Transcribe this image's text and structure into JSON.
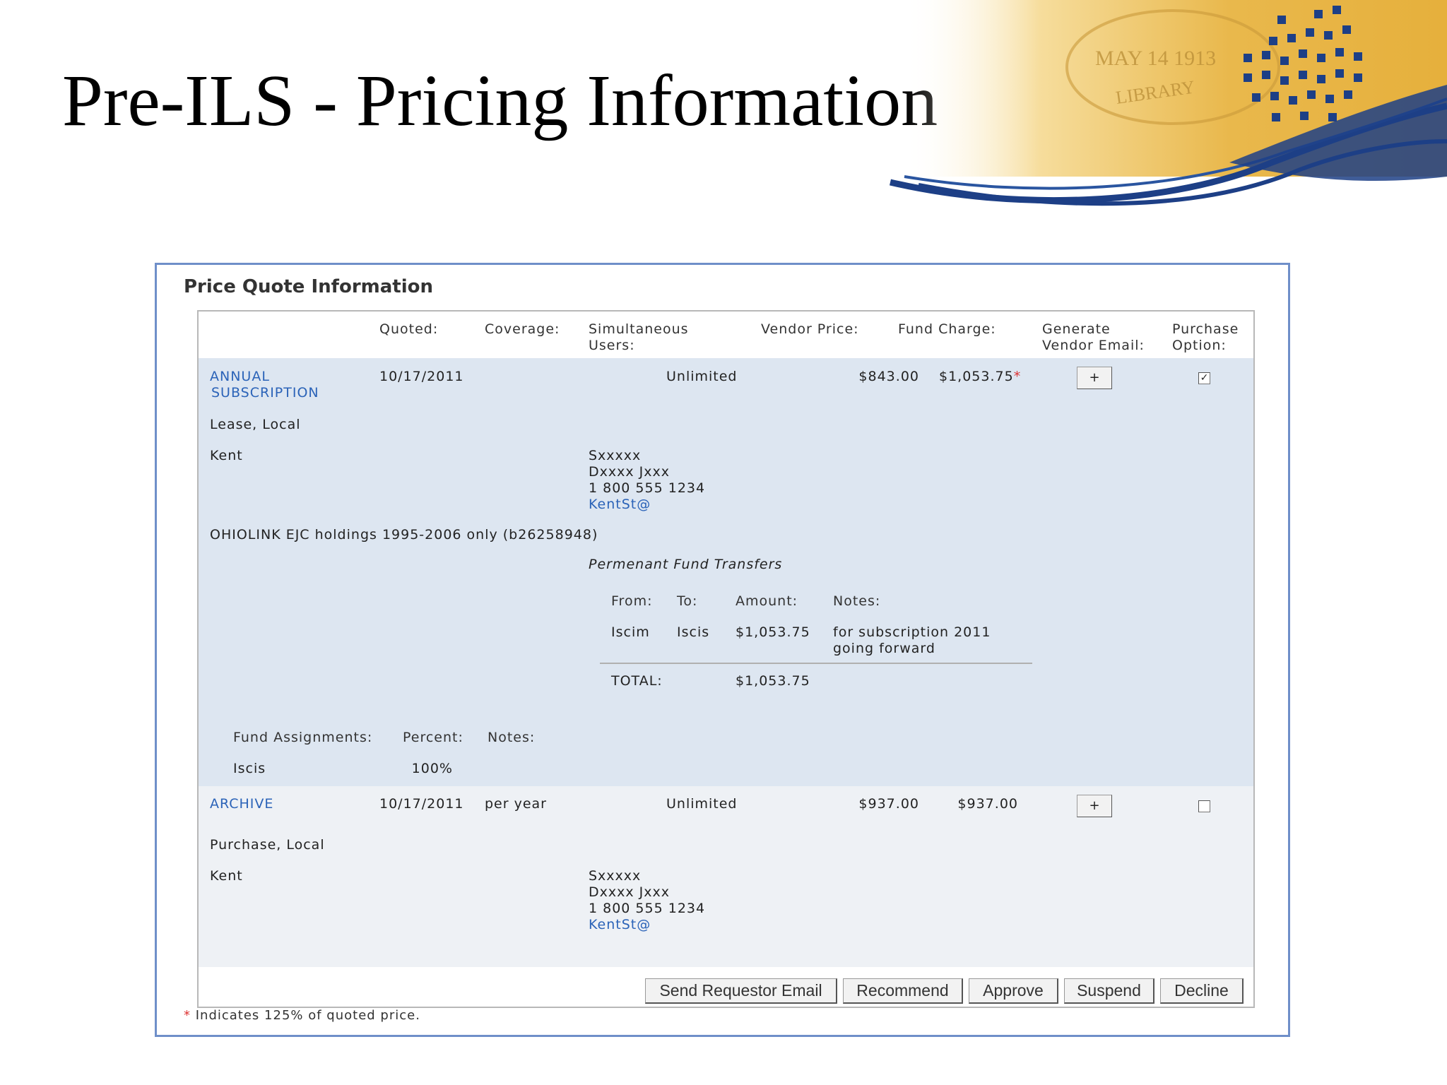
{
  "slide": {
    "title": "Pre-ILS - Pricing Information"
  },
  "banner": {
    "stamp_text": "MAY 14 1913",
    "stamp_subtext": "LIBRARY"
  },
  "panel": {
    "title": "Price Quote Information",
    "columns": [
      "Quoted:",
      "Coverage:",
      "Simultaneous Users:",
      "Vendor Price:",
      "Fund Charge:",
      "Generate Vendor Email:",
      "Purchase Option:"
    ],
    "columns_split": {
      "simultaneous_1": "Simultaneous",
      "simultaneous_2": "Users:",
      "generate_1": "Generate",
      "generate_2": "Vendor Email:",
      "purchase_1": "Purchase",
      "purchase_2": "Option:"
    },
    "quotes": [
      {
        "name_line1": "ANNUAL",
        "name_line2": "SUBSCRIPTION",
        "quoted": "10/17/2011",
        "coverage": "",
        "users": "Unlimited",
        "vendor_price": "$843.00",
        "fund_charge": "$1,053.75",
        "fund_charge_mark": "*",
        "email_button": "+",
        "purchase_checked": true,
        "terms": "Lease, Local",
        "location": "Kent",
        "contact": [
          "Sxxxxx",
          "Dxxxx Jxxx",
          "1 800 555 1234"
        ],
        "contact_email": "KentSt@",
        "holdings_note": "OHIOLINK EJC holdings 1995-2006 only (b26258948)",
        "transfers": {
          "title": "Permenant Fund Transfers",
          "headers": [
            "From:",
            "To:",
            "Amount:",
            "Notes:"
          ],
          "rows": [
            {
              "from": "Iscim",
              "to": "Iscis",
              "amount": "$1,053.75",
              "notes_line1": "for subscription 2011",
              "notes_line2": "going forward"
            }
          ],
          "total_label": "TOTAL:",
          "total_amount": "$1,053.75"
        },
        "assignments": {
          "headers": [
            "Fund Assignments:",
            "Percent:",
            "Notes:"
          ],
          "rows": [
            {
              "fund": "Iscis",
              "percent": "100%",
              "notes": ""
            }
          ]
        }
      },
      {
        "name_line1": "ARCHIVE",
        "quoted": "10/17/2011",
        "coverage": "per year",
        "users": "Unlimited",
        "vendor_price": "$937.00",
        "fund_charge": "$937.00",
        "email_button": "+",
        "purchase_checked": false,
        "terms": "Purchase, Local",
        "location": "Kent",
        "contact": [
          "Sxxxxx",
          "Dxxxx Jxxx",
          "1 800 555 1234"
        ],
        "contact_email": "KentSt@"
      }
    ],
    "actions": [
      "Send Requestor Email",
      "Recommend",
      "Approve",
      "Suspend",
      "Decline"
    ],
    "footnote_mark": "*",
    "footnote": "Indicates 125% of quoted price."
  },
  "colors": {
    "link": "#2b63b8",
    "band": "#dde6f1",
    "border": "#6f8fc9",
    "accent_gold": "#e8b94a",
    "accent_blue": "#1d3f86"
  }
}
